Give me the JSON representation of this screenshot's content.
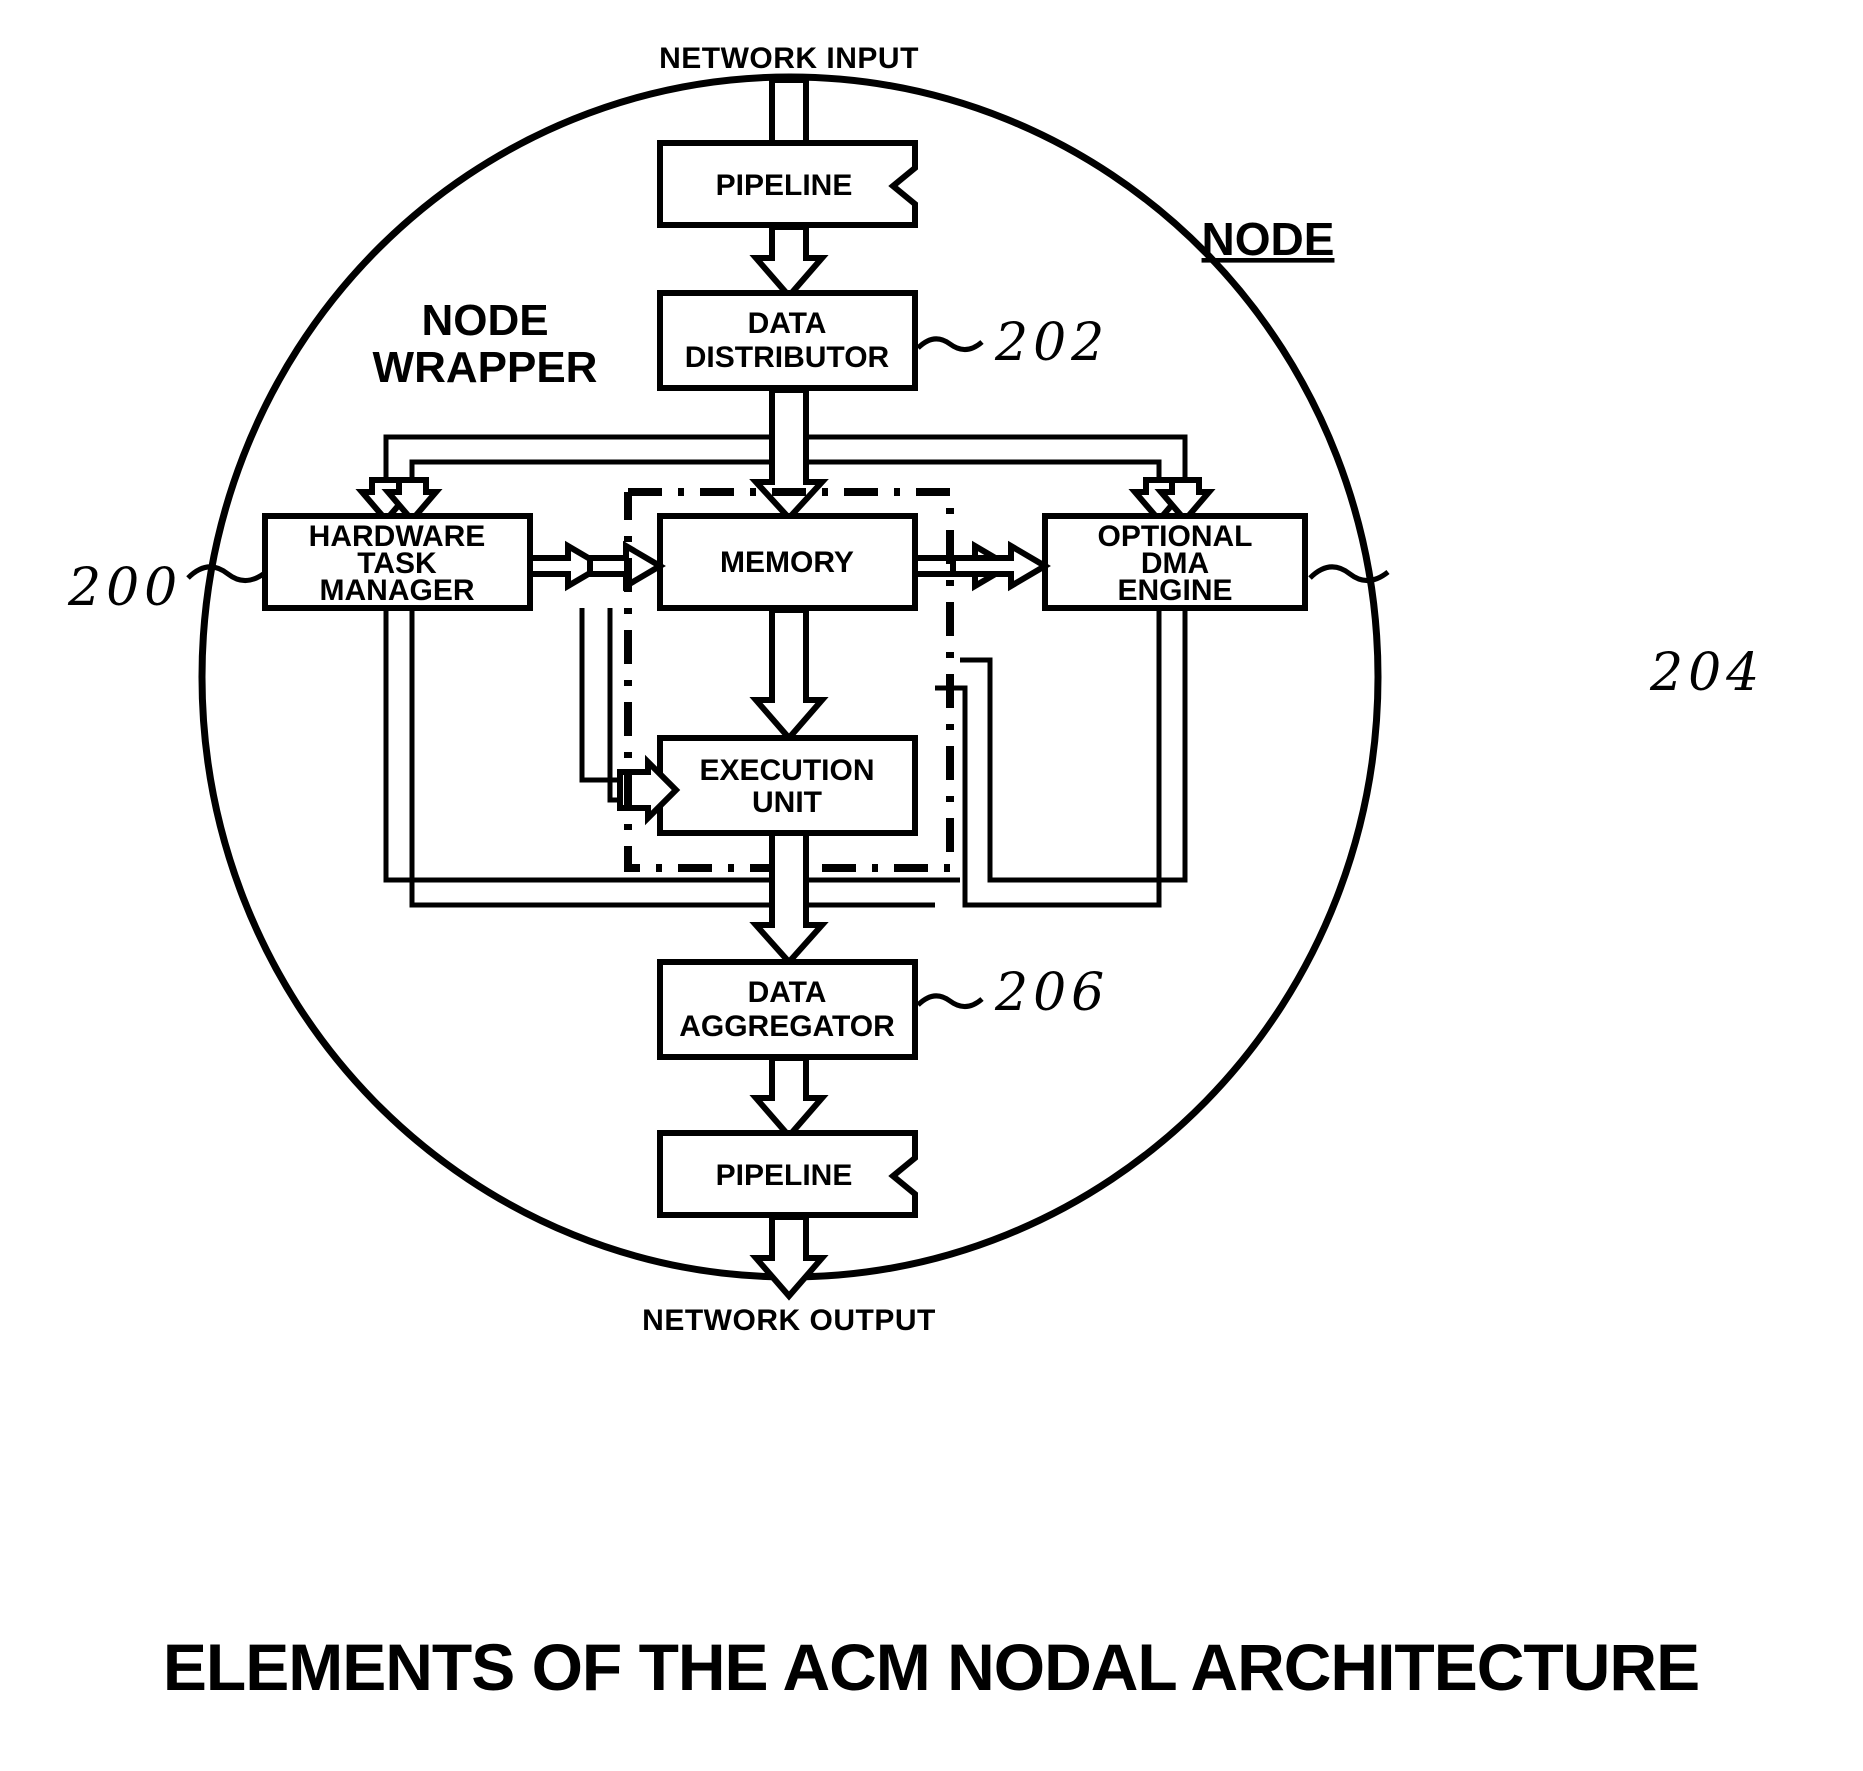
{
  "figure": {
    "title": "ELEMENTS OF THE ACM NODAL ARCHITECTURE",
    "node_label": "NODE",
    "node_wrapper_label_line1": "NODE",
    "node_wrapper_label_line2": "WRAPPER",
    "network_input_label": "NETWORK INPUT",
    "network_output_label": "NETWORK OUTPUT"
  },
  "blocks": {
    "pipeline_top": {
      "label": "PIPELINE"
    },
    "data_distributor": {
      "line1": "DATA",
      "line2": "DISTRIBUTOR"
    },
    "hardware_task_manager": {
      "line1": "HARDWARE",
      "line2": "TASK",
      "line3": "MANAGER"
    },
    "memory": {
      "label": "MEMORY"
    },
    "optional_dma_engine": {
      "line1": "OPTIONAL",
      "line2": "DMA",
      "line3": "ENGINE"
    },
    "execution_unit": {
      "line1": "EXECUTION",
      "line2": "UNIT"
    },
    "data_aggregator": {
      "line1": "DATA",
      "line2": "AGGREGATOR"
    },
    "pipeline_bottom": {
      "label": "PIPELINE"
    }
  },
  "reference_numerals": {
    "node_wrapper_ref": "200",
    "data_distributor_ref": "202",
    "dma_engine_ref": "204",
    "data_aggregator_ref": "206"
  },
  "colors": {
    "ink": "#000000",
    "paper": "#ffffff"
  }
}
